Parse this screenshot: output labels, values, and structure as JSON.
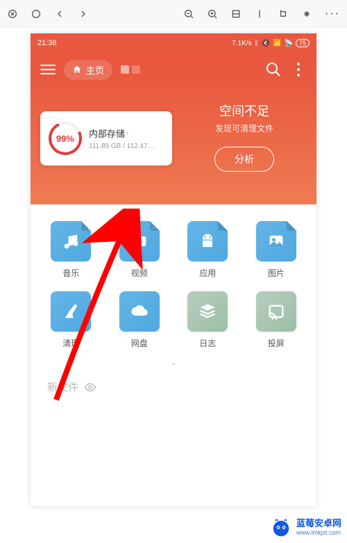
{
  "browser": {
    "close_icon": "close",
    "refresh_icon": "refresh",
    "back_icon": "back",
    "forward_icon": "forward",
    "zoom_out_icon": "zoom-out",
    "zoom_in_icon": "zoom-in",
    "fit_icon": "fit",
    "rotate_icon": "rotate",
    "fullscreen_icon": "fullscreen",
    "more_icon": "···"
  },
  "status_bar": {
    "time": "21:36",
    "speed": "7.1K/s",
    "battery": "75"
  },
  "header": {
    "home_label": "主页"
  },
  "banner": {
    "storage_percent": "99%",
    "storage_title": "内部存储",
    "storage_sub": "111.89 GB / 112.47…",
    "space_title": "空间不足",
    "space_sub": "发现可清理文件",
    "analyze_btn": "分析"
  },
  "grid": {
    "items": [
      {
        "label": "音乐",
        "icon": "music",
        "tone": "blue",
        "folded": true
      },
      {
        "label": "视频",
        "icon": "video",
        "tone": "blue",
        "folded": true
      },
      {
        "label": "应用",
        "icon": "android",
        "tone": "blue",
        "folded": true
      },
      {
        "label": "图片",
        "icon": "image",
        "tone": "blue",
        "folded": true
      },
      {
        "label": "清理",
        "icon": "broom",
        "tone": "blue",
        "folded": false
      },
      {
        "label": "网盘",
        "icon": "cloud",
        "tone": "blue",
        "folded": false
      },
      {
        "label": "日志",
        "icon": "stack",
        "tone": "sage",
        "folded": false
      },
      {
        "label": "投屏",
        "icon": "cast",
        "tone": "sage",
        "folded": false
      }
    ]
  },
  "new_file": {
    "label": "新文件"
  },
  "watermark": {
    "name": "蓝莓安卓网",
    "url": "www.lmkjst.com"
  }
}
